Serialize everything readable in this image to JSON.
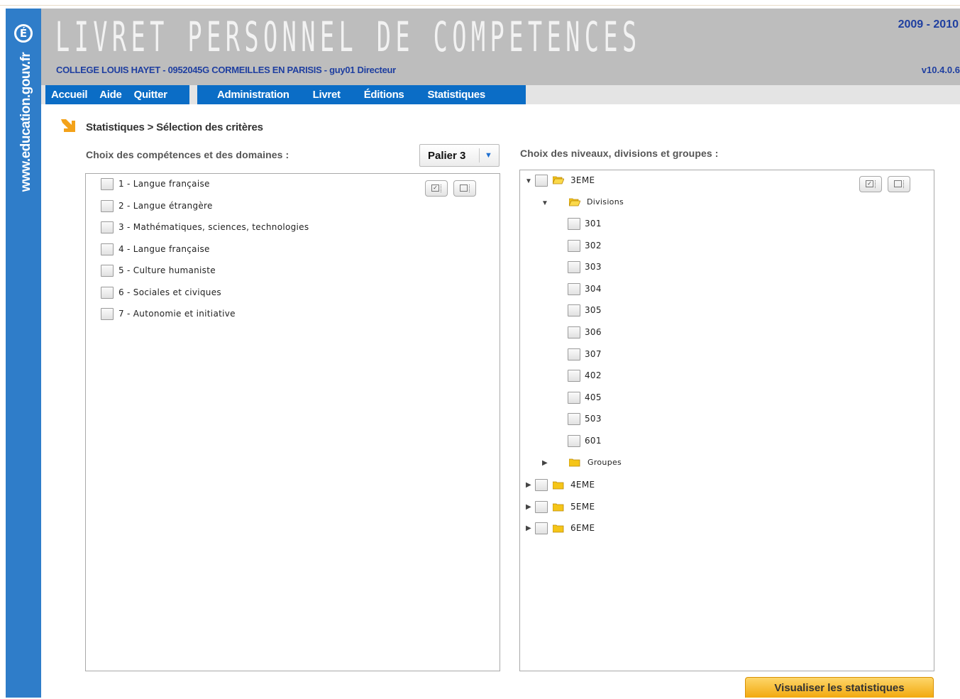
{
  "sidebar": {
    "logo_letter": "É",
    "url": "www.education.gouv.fr"
  },
  "header": {
    "title": "LIVRET PERSONNEL DE COMPETENCES",
    "year": "2009 - 2010",
    "school": "COLLEGE LOUIS HAYET  - 0952045G CORMEILLES EN PARISIS - guy01 Directeur",
    "version": "v10.4.0.6"
  },
  "menu": {
    "left": [
      "Accueil",
      "Aide",
      "Quitter"
    ],
    "right": [
      "Administration",
      "Livret",
      "Éditions",
      "Statistiques"
    ]
  },
  "breadcrumb": "Statistiques > Sélection des critères",
  "left_panel": {
    "label": "Choix des compétences et des domaines :",
    "palier": "Palier 3",
    "items": [
      "1 - Langue française",
      "2 - Langue étrangère",
      "3 - Mathématiques, sciences, technologies",
      "4 - Langue française",
      "5 - Culture humaniste",
      "6 - Sociales et civiques",
      "7 - Autonomie et initiative"
    ]
  },
  "right_panel": {
    "label": "Choix des niveaux, divisions et groupes :",
    "level_3": "3EME",
    "divisions_label": "Divisions",
    "divisions": [
      "301",
      "302",
      "303",
      "304",
      "305",
      "306",
      "307",
      "402",
      "405",
      "503",
      "601"
    ],
    "groups_label": "Groupes",
    "other_levels": [
      "4EME",
      "5EME",
      "6EME"
    ]
  },
  "icons": {
    "check_all": "check-all-icon",
    "uncheck_all": "uncheck-all-icon",
    "folder_color": "#f5c518",
    "accent": "#0b6dc6"
  },
  "action_button": "Visualiser les statistiques"
}
